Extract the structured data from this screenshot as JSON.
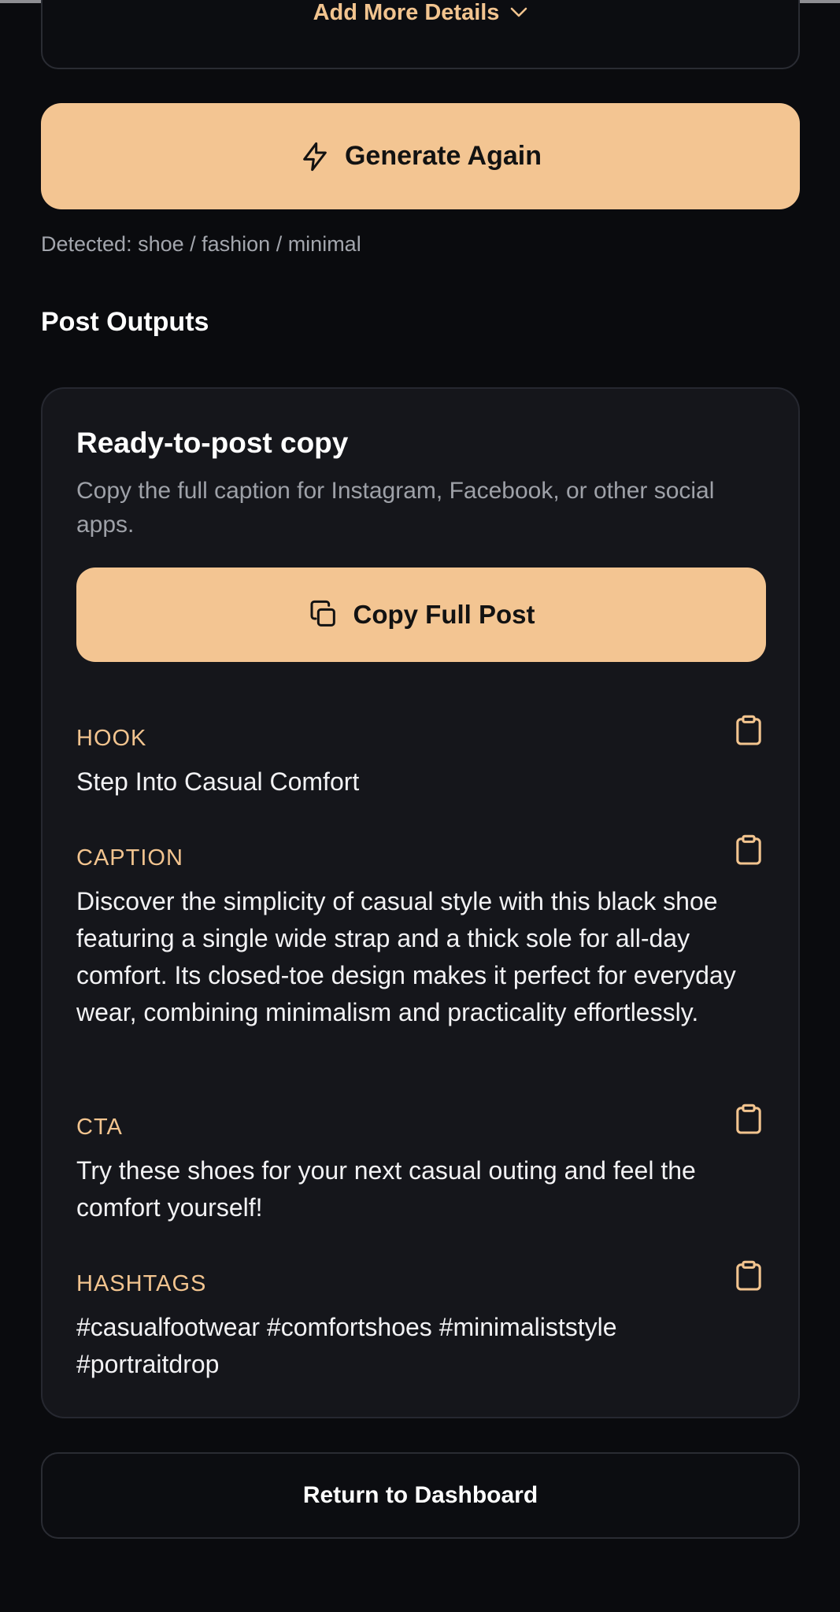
{
  "details": {
    "toggle_label": "Add More Details"
  },
  "generate": {
    "label": "Generate Again"
  },
  "detected": "Detected: shoe / fashion / minimal",
  "section_title": "Post Outputs",
  "card": {
    "title": "Ready-to-post copy",
    "subtitle": "Copy the full caption for Instagram, Facebook, or other social apps.",
    "copy_full_label": "Copy Full Post",
    "fields": [
      {
        "label": "HOOK",
        "value": "Step Into Casual Comfort"
      },
      {
        "label": "CAPTION",
        "value": "Discover the simplicity of casual style with this black shoe featuring a single wide strap and a thick sole for all-day comfort. Its closed-toe design makes it perfect for everyday wear, combining minimalism and practicality effortlessly."
      },
      {
        "label": "CTA",
        "value": "Try these shoes for your next casual outing and feel the comfort yourself!"
      },
      {
        "label": "HASHTAGS",
        "value": "#casualfootwear #comfortshoes #minimaliststyle #portraitdrop"
      }
    ]
  },
  "return_label": "Return to Dashboard",
  "colors": {
    "accent": "#f3c592",
    "label": "#f2c48f",
    "background": "#0a0b0e",
    "card": "#15161b"
  },
  "icons": {
    "details_toggle": "chevron-down-icon",
    "generate": "lightning-icon",
    "copy_full": "copy-icon",
    "field_copy": "clipboard-icon"
  }
}
